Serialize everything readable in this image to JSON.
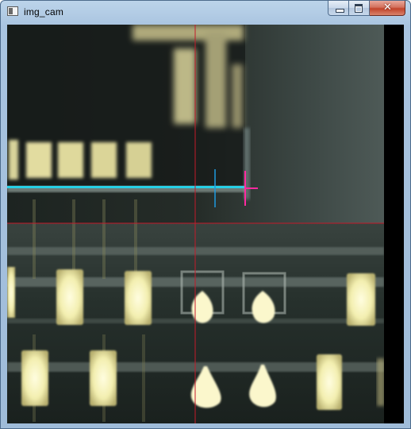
{
  "window": {
    "title": "img_cam",
    "buttons": {
      "minimize_icon": "minimize-icon",
      "maximize_icon": "maximize-icon",
      "close_icon": "close-icon",
      "close_glyph": "✕"
    }
  },
  "colors": {
    "frame": "#9fbcd9",
    "crosshair_red": "#c41a2a",
    "edge_cyan": "#27d0e6",
    "marker_magenta": "#ff2aa0",
    "marker_blue": "#1e9be0",
    "pad_yellow": "#f3f0b8"
  },
  "camera": {
    "feed_label": "camera-feed",
    "overlays": [
      "red-crosshair",
      "cyan-edge-line",
      "blue-tick-marker",
      "magenta-corner-marker"
    ]
  }
}
